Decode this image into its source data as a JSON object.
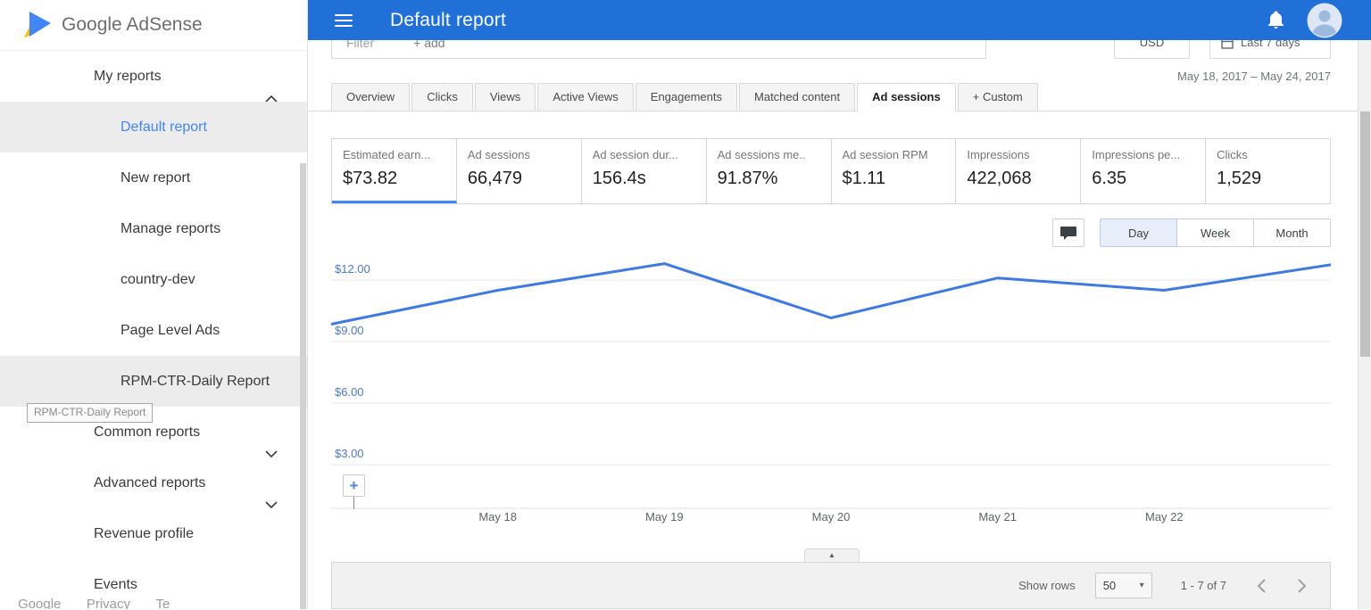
{
  "brand": {
    "name": "Google AdSense"
  },
  "header": {
    "title": "Default report"
  },
  "colors": {
    "header_blue": "#2170d8",
    "accent_blue": "#4285f4",
    "chart_line": "#3f7ae0",
    "selected_row_bg": "#ececec"
  },
  "sidebar": {
    "items": [
      {
        "label": "My reports",
        "type": "parent",
        "chevron": "up"
      },
      {
        "label": "Default report",
        "type": "child",
        "selected": true
      },
      {
        "label": "New report",
        "type": "child"
      },
      {
        "label": "Manage reports",
        "type": "child"
      },
      {
        "label": "country-dev",
        "type": "child"
      },
      {
        "label": "Page Level Ads",
        "type": "child"
      },
      {
        "label": "RPM-CTR-Daily Report",
        "type": "child",
        "hovered": true
      },
      {
        "label": "Common reports",
        "type": "parent",
        "chevron": "down"
      },
      {
        "label": "Advanced reports",
        "type": "parent",
        "chevron": "down"
      },
      {
        "label": "Revenue profile",
        "type": "parent"
      },
      {
        "label": "Events",
        "type": "parent"
      }
    ],
    "tooltip": "RPM-CTR-Daily Report",
    "footer_links": [
      "Google",
      "Privacy",
      "Te"
    ]
  },
  "toolbar": {
    "filter_label": "Filter",
    "add_label": "+ add",
    "currency": "USD",
    "date_preset": "Last 7 days",
    "date_range": "May 18, 2017 – May 24, 2017"
  },
  "tabs": [
    {
      "label": "Overview"
    },
    {
      "label": "Clicks"
    },
    {
      "label": "Views"
    },
    {
      "label": "Active Views"
    },
    {
      "label": "Engagements"
    },
    {
      "label": "Matched content"
    },
    {
      "label": "Ad sessions",
      "selected": true
    },
    {
      "label": "+ Custom"
    }
  ],
  "metrics": [
    {
      "label": "Estimated earn...",
      "value": "$73.82",
      "selected": true
    },
    {
      "label": "Ad sessions",
      "value": "66,479"
    },
    {
      "label": "Ad session dur...",
      "value": "156.4s"
    },
    {
      "label": "Ad sessions me..",
      "value": "91.87%"
    },
    {
      "label": "Ad session RPM",
      "value": "$1.11"
    },
    {
      "label": "Impressions",
      "value": "422,068"
    },
    {
      "label": "Impressions pe...",
      "value": "6.35"
    },
    {
      "label": "Clicks",
      "value": "1,529"
    }
  ],
  "granularity": {
    "options": [
      {
        "label": "Day",
        "selected": true
      },
      {
        "label": "Week"
      },
      {
        "label": "Month"
      }
    ]
  },
  "chart_data": {
    "type": "line",
    "title": "",
    "series": [
      {
        "name": "Estimated earnings",
        "values": [
          9.85,
          11.5,
          12.8,
          10.15,
          12.1,
          11.5,
          12.75
        ]
      }
    ],
    "x_tick_labels": [
      "May 18",
      "May 19",
      "May 20",
      "May 21",
      "May 22"
    ],
    "x_tick_positions": [
      1,
      2,
      3,
      4,
      5
    ],
    "y_ticks": [
      {
        "label": "$12.00",
        "value": 12
      },
      {
        "label": "$9.00",
        "value": 9
      },
      {
        "label": "$6.00",
        "value": 6
      },
      {
        "label": "$3.00",
        "value": 3
      }
    ],
    "ylim": [
      0.9,
      13.0
    ],
    "grid": true,
    "legend": "none",
    "line_color": "#3f7ae0"
  },
  "pager": {
    "show_rows_label": "Show rows",
    "rows_per_page": "50",
    "range_text": "1 - 7 of 7"
  }
}
